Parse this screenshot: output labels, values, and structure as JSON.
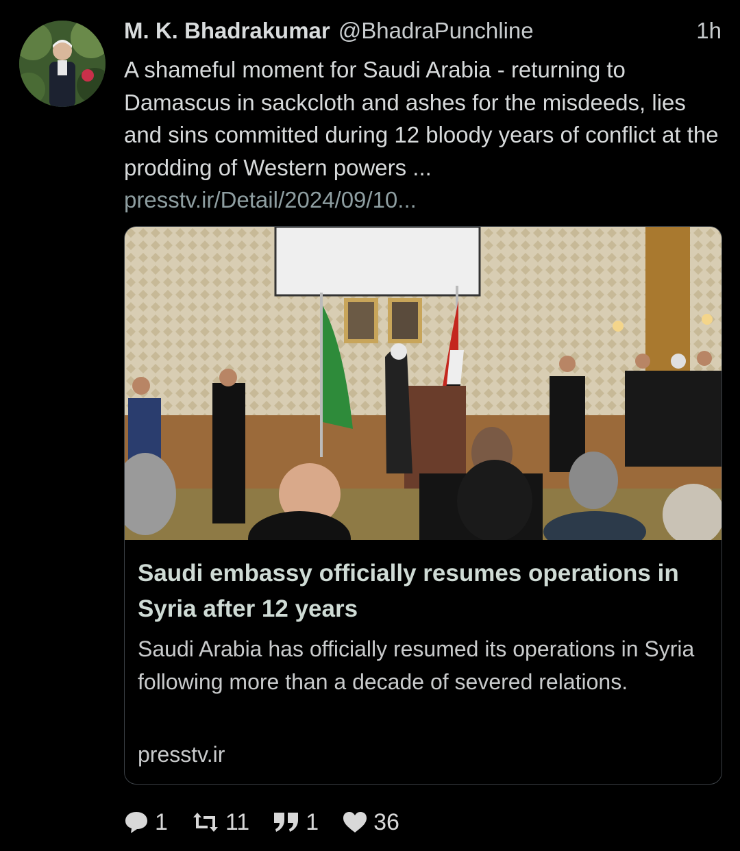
{
  "tweet": {
    "author_name": "M. K. Bhadrakumar",
    "handle": "@BhadraPunchline",
    "time": "1h",
    "text": "A shameful moment for Saudi Arabia - returning to Damascus in sackcloth and ashes for the misdeeds, lies and sins committed during 12 bloody years of conflict at the prodding of Western powers ...",
    "link": "presstv.ir/Detail/2024/09/10..."
  },
  "card": {
    "title": "Saudi embassy officially resumes operations in Syria after 12 years",
    "description": "Saudi Arabia has officially resumed its operations in Syria following more than a decade of severed relations.",
    "domain": "presstv.ir"
  },
  "actions": {
    "replies": "1",
    "retweets": "11",
    "quotes": "1",
    "likes": "36"
  },
  "icons": [
    "reply-icon",
    "retweet-icon",
    "quote-icon",
    "like-icon"
  ]
}
